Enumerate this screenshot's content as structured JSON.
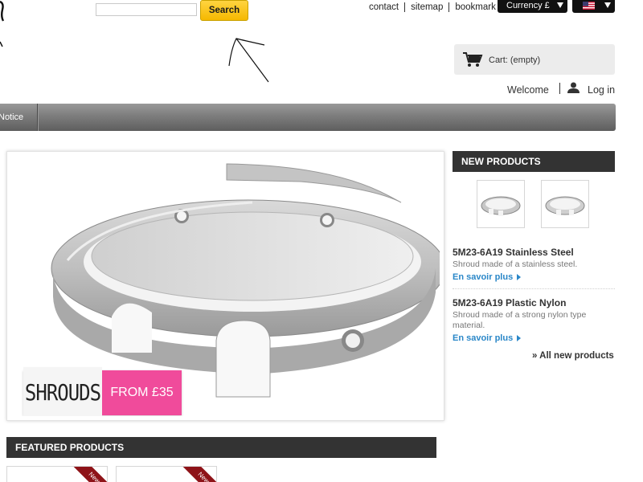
{
  "header": {
    "search": {
      "placeholder": "",
      "value": "",
      "button_label": "Search"
    },
    "top_links": [
      {
        "label": "contact"
      },
      {
        "label": "sitemap"
      },
      {
        "label": "bookmark"
      }
    ],
    "currency_label": "Currency £",
    "cart_label": "Cart: (empty)",
    "welcome_text": "Welcome",
    "login_label": "Log in"
  },
  "nav": {
    "items": [
      {
        "label": "Notice"
      }
    ]
  },
  "banner": {
    "brand": "SHROUDS",
    "price": "FROM £35"
  },
  "new_products": {
    "title": "NEW PRODUCTS",
    "items": [
      {
        "name": "5M23-6A19 Stainless Steel",
        "description": "Shroud made of a stainless steel.",
        "more": "En savoir plus"
      },
      {
        "name": "5M23-6A19 Plastic Nylon",
        "description": "Shroud made of a strong nylon type material.",
        "more": "En savoir plus"
      }
    ],
    "all_link": "» All new products"
  },
  "featured": {
    "title": "FEATURED PRODUCTS",
    "ribbon": "New"
  },
  "colors": {
    "accent_yellow": "#f5b800",
    "dark_header": "#333333",
    "link_blue": "#2a87c8",
    "promo_pink": "#f04b9b",
    "ribbon_red": "#8e1318"
  }
}
